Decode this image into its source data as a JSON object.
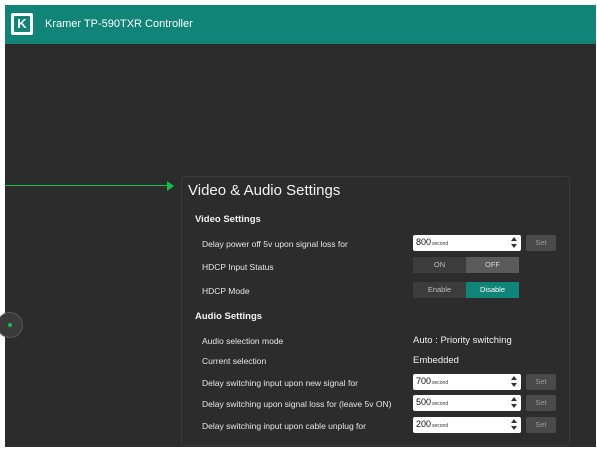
{
  "header": {
    "title": "Kramer TP-590TXR Controller",
    "logo": {
      "letter": "K",
      "icon": "kramer-logo-icon"
    }
  },
  "panel": {
    "title": "Video & Audio Settings",
    "video": {
      "heading": "Video Settings",
      "delay_power_off": {
        "label": "Delay power off 5v upon signal loss for",
        "value": "800",
        "unit": "second",
        "set_label": "Set"
      },
      "hdcp_input_status": {
        "label": "HDCP Input Status",
        "on_label": "ON",
        "off_label": "OFF"
      },
      "hdcp_mode": {
        "label": "HDCP Mode",
        "enable_label": "Enable",
        "disable_label": "Disable",
        "selected": "Disable"
      }
    },
    "audio": {
      "heading": "Audio Settings",
      "selection_mode": {
        "label": "Audio selection mode",
        "value": "Auto : Priority switching"
      },
      "current_selection": {
        "label": "Current selection",
        "value": "Embedded"
      },
      "delay_new_signal": {
        "label": "Delay switching input upon new signal for",
        "value": "700",
        "unit": "second",
        "set_label": "Set"
      },
      "delay_signal_loss": {
        "label": "Delay switching upon signal loss for (leave 5v ON)",
        "value": "500",
        "unit": "second",
        "set_label": "Set"
      },
      "delay_cable_unplug": {
        "label": "Delay switching input upon cable unplug for",
        "value": "200",
        "unit": "second",
        "set_label": "Set"
      }
    }
  },
  "colors": {
    "header": "#0f8477",
    "background": "#2c2c2c",
    "accent_green": "#0fc04a",
    "active_toggle": "#0f8477"
  }
}
